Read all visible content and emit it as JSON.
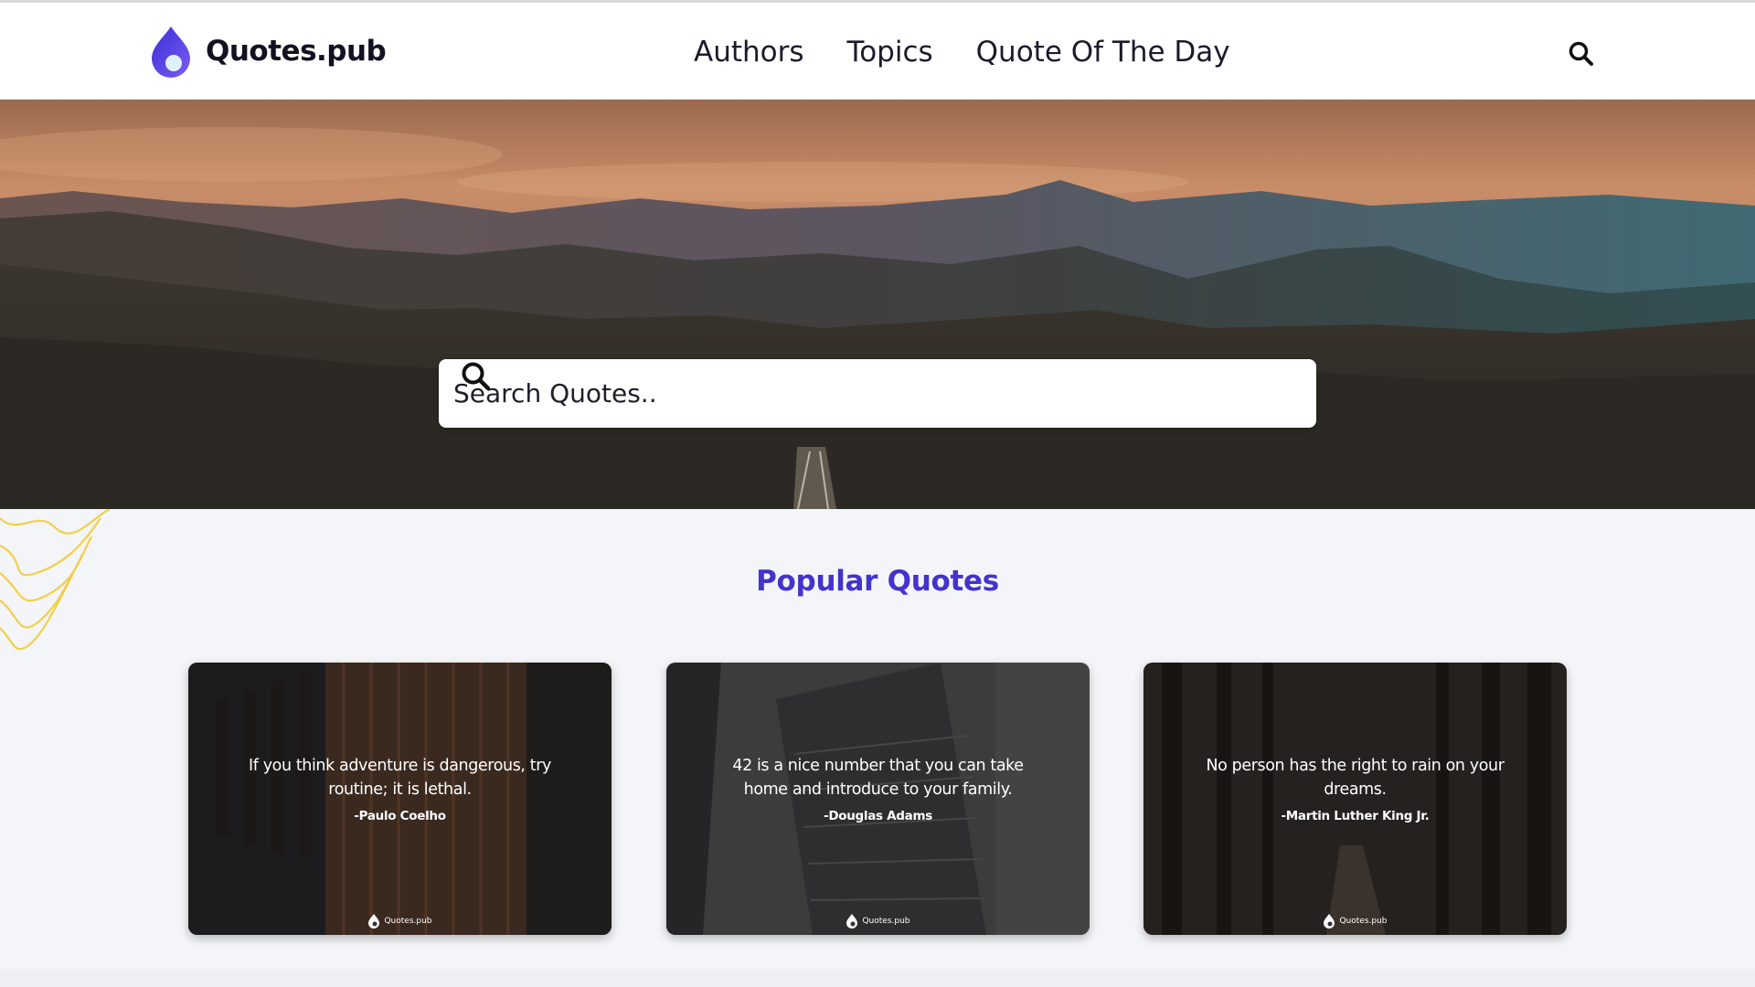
{
  "header": {
    "logo_text": "Quotes.pub",
    "nav": [
      {
        "label": "Authors"
      },
      {
        "label": "Topics"
      },
      {
        "label": "Quote Of The Day"
      }
    ],
    "search_icon": "search-icon"
  },
  "hero": {
    "search": {
      "placeholder": "Search Quotes.."
    }
  },
  "popular": {
    "title": "Popular Quotes",
    "cards": [
      {
        "quote": "If you think adventure is dangerous, try routine; it is lethal.",
        "author": "-Paulo Coelho",
        "brand": "Quotes.pub"
      },
      {
        "quote": "42 is a nice number that you can take home and introduce to your family.",
        "author": "-Douglas Adams",
        "brand": "Quotes.pub"
      },
      {
        "quote": "No person has the right to rain on your dreams.",
        "author": "-Martin Luther King Jr.",
        "brand": "Quotes.pub"
      }
    ]
  },
  "colors": {
    "accent": "#4433cc",
    "logo_blue": "#5b3fe0",
    "wave_yellow": "#f2cf4a"
  }
}
